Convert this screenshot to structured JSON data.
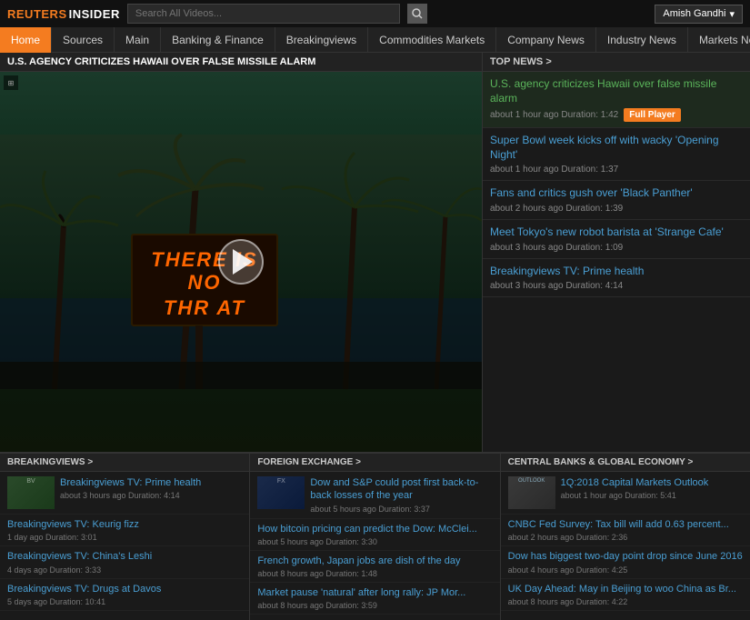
{
  "header": {
    "logo_reuters": "REUTERS",
    "logo_insider": "INSIDER",
    "search_placeholder": "Search All Videos...",
    "user_name": "Amish Gandhi",
    "user_chevron": "▾"
  },
  "nav": {
    "items": [
      {
        "label": "Home"
      },
      {
        "label": "Sources"
      },
      {
        "label": "Main"
      },
      {
        "label": "Banking & Finance"
      },
      {
        "label": "Breakingviews"
      },
      {
        "label": "Commodities Markets"
      },
      {
        "label": "Company News"
      },
      {
        "label": "Industry News"
      },
      {
        "label": "Markets News"
      },
      {
        "label": "..."
      }
    ]
  },
  "video": {
    "title": "U.S. AGENCY CRITICIZES HAWAII OVER FALSE MISSILE ALARM",
    "sign_line1": "THERE IS",
    "sign_line2": "NO",
    "sign_line3": "THR  AT"
  },
  "top_news": {
    "header": "TOP NEWS >",
    "items": [
      {
        "title": "U.S. agency criticizes Hawaii over false missile alarm",
        "meta": "about 1 hour ago  Duration: 1:42",
        "active": true,
        "has_btn": true,
        "btn_label": "Full Player"
      },
      {
        "title": "Super Bowl week kicks off with wacky 'Opening Night'",
        "meta": "about 1 hour ago  Duration: 1:37",
        "active": false,
        "has_btn": false
      },
      {
        "title": "Fans and critics gush over 'Black Panther'",
        "meta": "about 2 hours ago  Duration: 1:39",
        "active": false,
        "has_btn": false
      },
      {
        "title": "Meet Tokyo's new robot barista at 'Strange Cafe'",
        "meta": "about 3 hours ago  Duration: 1:09",
        "active": false,
        "has_btn": false
      },
      {
        "title": "Breakingviews TV: Prime health",
        "meta": "about 3 hours ago  Duration: 4:14",
        "active": false,
        "has_btn": false
      }
    ]
  },
  "bottom": {
    "sections": [
      {
        "header": "BREAKINGVIEWS >",
        "featured": {
          "title": "Breakingviews TV: Prime health",
          "meta": "about 3 hours ago  Duration: 4:14",
          "thumb_type": "green"
        },
        "items": [
          {
            "title": "Breakingviews TV: Keurig fizz",
            "meta": "1 day ago  Duration: 3:01"
          },
          {
            "title": "Breakingviews TV: China's Leshi",
            "meta": "4 days ago  Duration: 3:33"
          },
          {
            "title": "Breakingviews TV: Drugs at Davos",
            "meta": "5 days ago  Duration: 10:41"
          }
        ]
      },
      {
        "header": "FOREIGN EXCHANGE >",
        "featured": {
          "title": "Dow and S&P could post first back-to-back losses of the year",
          "meta": "about 5 hours ago  Duration: 3:37",
          "thumb_type": "blue"
        },
        "items": [
          {
            "title": "How bitcoin pricing can predict the Dow: McClei...",
            "meta": "about 5 hours ago  Duration: 3:30"
          },
          {
            "title": "French growth, Japan jobs are dish of the day",
            "meta": "about 8 hours ago  Duration: 1:48"
          },
          {
            "title": "Market pause 'natural' after long rally: JP Mor...",
            "meta": "about 8 hours ago  Duration: 3:59"
          }
        ]
      },
      {
        "header": "CENTRAL BANKS & GLOBAL ECONOMY >",
        "featured": {
          "title": "1Q:2018 Capital Markets Outlook",
          "meta": "about 1 hour ago  Duration: 5:41",
          "thumb_type": "gray"
        },
        "items": [
          {
            "title": "CNBC Fed Survey: Tax bill will add 0.63 percent...",
            "meta": "about 2 hours ago  Duration: 2:36"
          },
          {
            "title": "Dow has biggest two-day point drop since June 2016",
            "meta": "about 4 hours ago  Duration: 4:25"
          },
          {
            "title": "UK Day Ahead: May in Beijing to woo China as Br...",
            "meta": "about 8 hours ago  Duration: 4:22"
          }
        ]
      }
    ]
  }
}
